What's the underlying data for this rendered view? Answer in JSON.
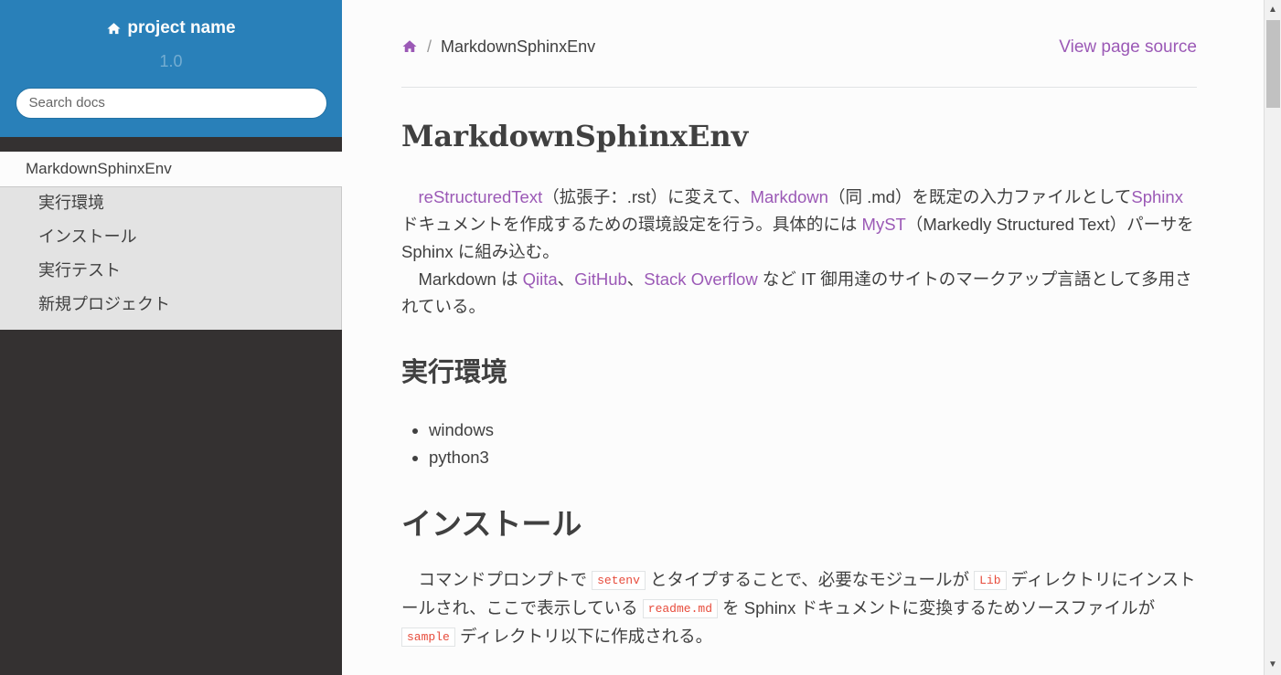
{
  "sidebar": {
    "project_name": "project name",
    "version": "1.0",
    "search_placeholder": "Search docs",
    "current_item": "MarkdownSphinxEnv",
    "sub_items": [
      "実行環境",
      "インストール",
      "実行テスト",
      "新規プロジェクト"
    ]
  },
  "breadcrumb": {
    "separator": "/",
    "current": "MarkdownSphinxEnv",
    "view_source": "View page source"
  },
  "page": {
    "title": "MarkdownSphinxEnv",
    "intro": {
      "lead": "　",
      "link_rst": "reStructuredText",
      "t1": "（拡張子：.rst）に変えて、",
      "link_md": "Markdown",
      "t2": "（同 .md）を既定の入力ファイルとして",
      "link_sphinx": "Sphinx",
      "t3": " ドキュメントを作成するための環境設定を行う。具体的には ",
      "link_myst": "MyST",
      "t4": "（Markedly Structured Text）パーサを Sphinx に組み込む。",
      "t5": "　Markdown は ",
      "link_qiita": "Qiita",
      "sep1": "、",
      "link_github": "GitHub",
      "sep2": "、",
      "link_so": "Stack Overflow",
      "t6": " など IT 御用達のサイトのマークアップ言語として多用されている。"
    },
    "section_env": {
      "heading": "実行環境",
      "items": [
        "windows",
        "python3"
      ]
    },
    "section_install": {
      "heading": "インストール",
      "lead": "　コマンドプロンプトで ",
      "code1": "setenv",
      "t1": " とタイプすることで、必要なモジュールが ",
      "code2": "Lib",
      "t2": " ディレクトリにインストールされ、ここで表示している ",
      "code3": "readme.md",
      "t3": " を Sphinx ドキュメントに変換するためソースファイルが ",
      "code4": "sample",
      "t4": " ディレクトリ以下に作成される。"
    }
  },
  "colors": {
    "sidebar_header": "#2980b9",
    "sidebar_bg": "#343131",
    "link": "#9b59b6",
    "code": "#e74c3c"
  }
}
